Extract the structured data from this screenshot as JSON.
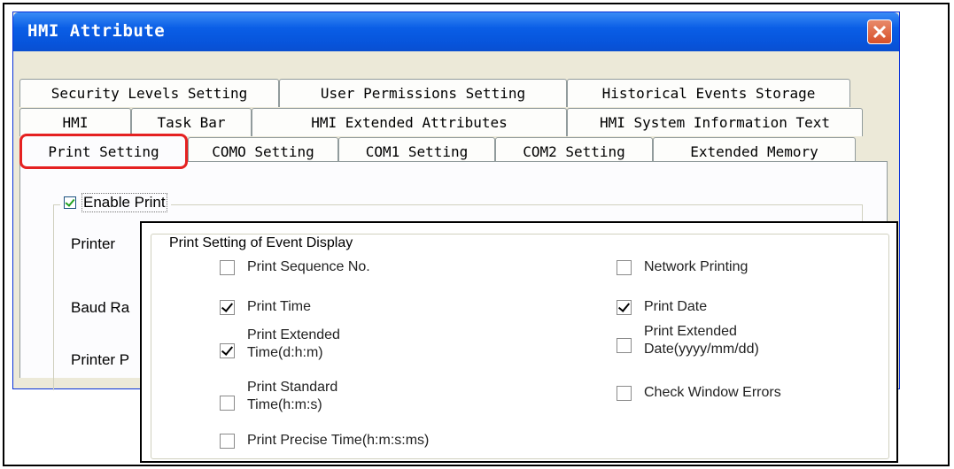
{
  "window": {
    "title": "HMI Attribute"
  },
  "tabs": {
    "row1": [
      "Security Levels Setting",
      "User Permissions Setting",
      "Historical Events Storage"
    ],
    "row2": [
      "HMI",
      "Task Bar",
      "HMI Extended Attributes",
      "HMI System Information Text"
    ],
    "row3": [
      "Print Setting",
      "COMO Setting",
      "COM1 Setting",
      "COM2 Setting",
      "Extended Memory"
    ],
    "selected": "Print Setting"
  },
  "print": {
    "enable_label": "Enable Print",
    "enable_checked": true,
    "printer_label": "Printer",
    "baud_label": "Baud Ra",
    "printer_p_label": "Printer P"
  },
  "event_display": {
    "legend": "Print Setting of Event Display",
    "options": [
      {
        "label": "Print Sequence No.",
        "checked": false
      },
      {
        "label": "Print Time",
        "checked": true
      },
      {
        "label": "Print Extended Time(d:h:m)",
        "line1": "Print Extended",
        "line2": "Time(d:h:m)",
        "checked": true
      },
      {
        "label": "Print Standard Time(h:m:s)",
        "line1": "Print Standard",
        "line2": "Time(h:m:s)",
        "checked": false
      },
      {
        "label": "Print Precise Time(h:m:s:ms)",
        "checked": false
      },
      {
        "label": "Network Printing",
        "checked": false
      },
      {
        "label": "Print Date",
        "checked": true
      },
      {
        "label": "Print Extended Date(yyyy/mm/dd)",
        "line1": "Print Extended",
        "line2": "Date(yyyy/mm/dd)",
        "checked": false
      },
      {
        "label": "Check Window Errors",
        "checked": false
      }
    ]
  },
  "colors": {
    "title_bar": "#0a5ee6",
    "highlight": "#e52121",
    "dialog_bg": "#ece9d8"
  }
}
